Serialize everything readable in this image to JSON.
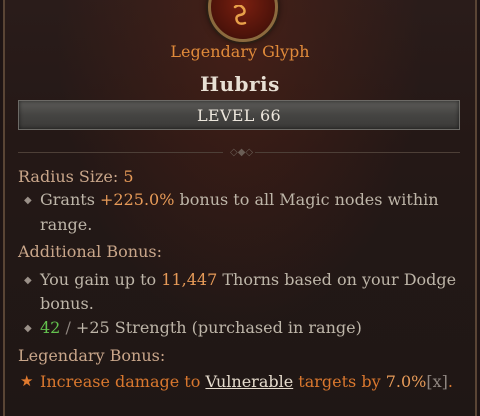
{
  "tooltip": {
    "subtitle": "Legendary Glyph",
    "title": "Hubris",
    "level": "LEVEL 66",
    "radius_label": "Radius Size:",
    "radius_value": "5",
    "grant_line1_pre": "Grants ",
    "grant_value": "+225.0%",
    "grant_line1_post": " bonus to all Magic nodes within",
    "grant_line2": "range.",
    "additional_label": "Additional Bonus:",
    "thorns_line1_pre": "You gain up to ",
    "thorns_value": "11,447",
    "thorns_line1_post": " Thorns based on your Dodge",
    "thorns_line2": "bonus.",
    "strength_current": "42",
    "strength_sep": " / ",
    "strength_rest": "+25 Strength (purchased in range)",
    "legendary_label": "Legendary Bonus:",
    "leg_pre": "Increase damage to ",
    "leg_keyword": "Vulnerable",
    "leg_mid": " targets by ",
    "leg_value": "7.0%",
    "leg_bracket": "[x]",
    "leg_end": "."
  },
  "colors": {
    "accent_orange": "#e69a58",
    "legendary_orange": "#d9772e",
    "active_green": "#63c24e",
    "label_tan": "#c9a68a"
  },
  "icons": {
    "emblem": "legendary-glyph-emblem-icon",
    "bullet": "diamond-bullet-icon",
    "legendary": "star-icon"
  }
}
